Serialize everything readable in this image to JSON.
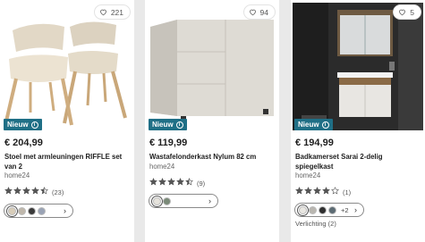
{
  "products": [
    {
      "favorites": "221",
      "badge": "Nieuw",
      "price": "€ 204,99",
      "title": "Stoel met armleuningen RIFFLE set van 2",
      "brand": "home24",
      "rating": 4.5,
      "reviews": "(23)",
      "swatches": [
        "#d8cdb9",
        "#bfb7ab",
        "#3a3a3a",
        "#9aa3b5"
      ],
      "more_colors": ""
    },
    {
      "favorites": "94",
      "badge": "Nieuw",
      "price": "€ 119,99",
      "title": "Wastafelonderkast Nylum 82 cm",
      "brand": "home24",
      "rating": 4.5,
      "reviews": "(9)",
      "swatches": [
        "#e6e3dc",
        "#7a8a78"
      ],
      "more_colors": ""
    },
    {
      "favorites": "5",
      "badge": "Nieuw",
      "price": "€ 194,99",
      "title": "Badkamerset Sarai 2-delig spiegelkast",
      "brand": "home24",
      "rating": 4,
      "reviews": "(1)",
      "swatches": [
        "#e9e7e2",
        "#b9b6b0",
        "#2f2f2f",
        "#5c6b73"
      ],
      "more_colors": "+2",
      "extra": "Verlichting (2)"
    }
  ],
  "colors": {
    "badge": "#1f6f86",
    "star": "#555555"
  },
  "icons": {
    "favorite": "heart-outline-icon",
    "info": "info-icon",
    "next": "chevron-right-icon"
  }
}
